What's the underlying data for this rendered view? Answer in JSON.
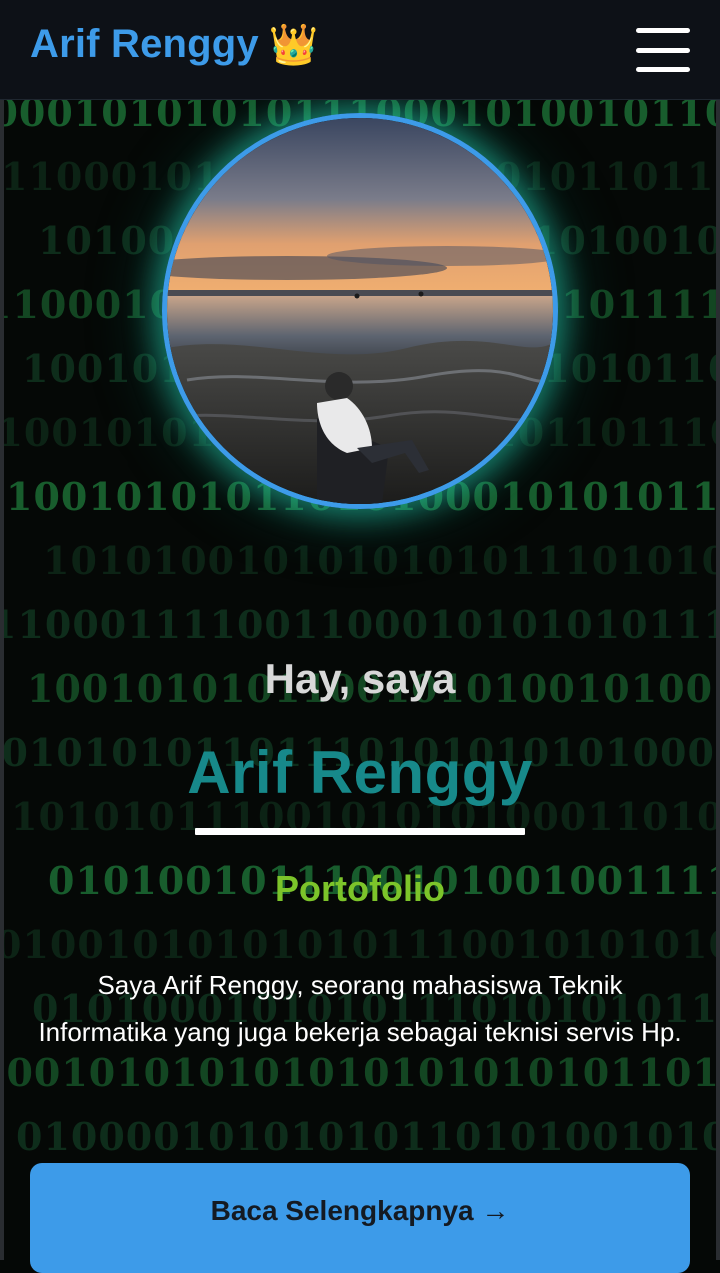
{
  "header": {
    "brand": "Arif Renggy",
    "brand_icon": "crown-icon",
    "brand_emoji": "👑",
    "menu_icon": "hamburger-menu-icon"
  },
  "background": {
    "style": "binary-matrix",
    "rows": [
      "10001010101011100010100101",
      "110001011100101010010110",
      "1010010100101011101010010",
      "11000101010100110101010111",
      "100101110010100101010101",
      "1100101011010100110101101",
      "1001010101101010001010101",
      "10101001010101010111010100101010",
      "11000111100110001010101011111",
      "1001010101100101010010100101",
      "0010101011011101010101010",
      "1010101110010101010001",
      "0101001011100101001001111",
      "01001010101010111001010101",
      "0101000101010111010101011",
      "10010101010101010101010110",
      "0100001010101011010100101"
    ],
    "colors": {
      "bright": "#1f7a3a",
      "dim": "#123a22"
    }
  },
  "hero": {
    "greeting": "Hay, saya",
    "name": "Arif Renggy",
    "role": "Portofolio",
    "bio": "Saya Arif Renggy, seorang mahasiswa Teknik Informatika yang juga bekerja sebagai teknisi servis Hp.",
    "cta_label": "Baca Selengkapnya →"
  },
  "colors": {
    "accent": "#3d9be9",
    "name": "#17898a",
    "role": "#7cc42a",
    "glow": "#22c9aa"
  }
}
